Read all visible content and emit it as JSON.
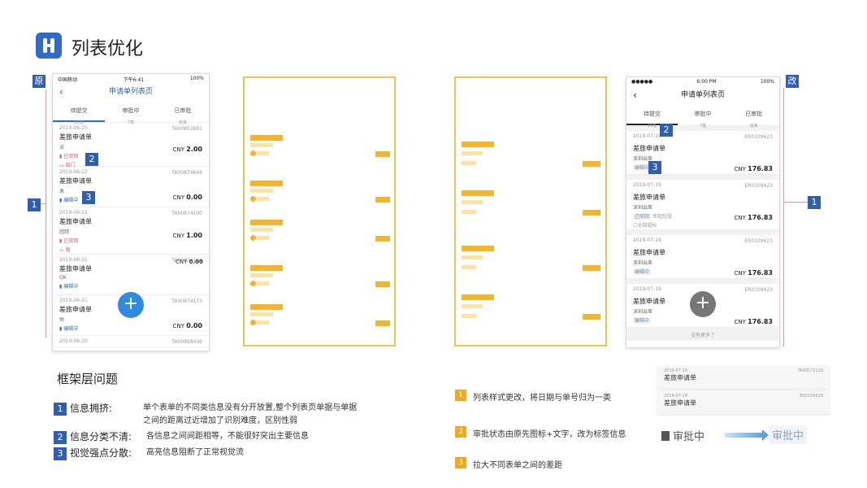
{
  "header": {
    "title": "列表优化"
  },
  "labels": {
    "orig": "原",
    "new": "改"
  },
  "markers": {
    "m1": "1",
    "m2": "2",
    "m3": "3"
  },
  "phone_orig": {
    "status": {
      "carrier": "中国移动",
      "time": "下午6:41",
      "battery": "100%"
    },
    "nav": {
      "back": "‹",
      "title": "申请单列表页"
    },
    "tabs": [
      {
        "label": "待提交",
        "sub": "19笔"
      },
      {
        "label": "审批中",
        "sub": "7笔"
      },
      {
        "label": "已审批",
        "sub": "结束"
      }
    ],
    "cards": [
      {
        "date": "2019-06-25",
        "no": "TA00853881",
        "title": "差旅申请单",
        "sub": "汝",
        "status": "已驳回",
        "status2": "部门",
        "cny": "CNY",
        "amount": "2.00"
      },
      {
        "date": "2019-06-22",
        "no": "TA00874648",
        "title": "差旅申请单",
        "sub": "发",
        "status": "编辑中",
        "cny": "CNY",
        "amount": "0.00"
      },
      {
        "date": "2019-06-21",
        "no": "TA00874100",
        "title": "差旅申请单",
        "sub": "团拜",
        "status": "已驳回",
        "status2": "版",
        "cny": "CNY",
        "amount": "1.00"
      },
      {
        "date": "2019-06-21",
        "no": "TA00874184",
        "title": "差旅申请单",
        "sub": "OK",
        "status": "编辑中",
        "cny": "CNY",
        "amount": "0.00"
      },
      {
        "date": "2019-06-21",
        "no": "TA00874173",
        "title": "差旅申请单",
        "sub": "恒",
        "status": "编辑中",
        "cny": "CNY",
        "amount": "0.00"
      },
      {
        "date": "2019-06-20",
        "no": "TA00868436"
      }
    ],
    "fab": "+"
  },
  "phone_new": {
    "status": {
      "carrier": "●●●●● ",
      "time": "6:00 PM",
      "battery": "100%"
    },
    "nav": {
      "back": "‹",
      "title": "申请单列表页"
    },
    "tabs": [
      {
        "label": "待提交",
        "sub": "15笔"
      },
      {
        "label": "审批中",
        "sub": "7笔"
      },
      {
        "label": "已审批",
        "sub": "结束"
      }
    ],
    "cards": [
      {
        "date": "2019-07-19",
        "no": "ER0109423",
        "title": "差旅申请单",
        "sub": "深圳出差",
        "status": "编辑中",
        "cny": "CNY",
        "amount": "176.83"
      },
      {
        "date": "2019-07-19",
        "no": "ER0109423",
        "title": "差旅申请单",
        "sub": "深圳出差",
        "status": "已驳回",
        "status_b": "审批阶段",
        "extra": "全部超标",
        "cny": "CNY",
        "amount": "176.83"
      },
      {
        "date": "2019-07-19",
        "no": "ER0109423",
        "title": "差旅申请单",
        "sub": "深圳出差",
        "status": "编辑中",
        "cny": "CNY",
        "amount": "176.83"
      },
      {
        "date": "2019-07-19",
        "no": "ER0109423",
        "title": "差旅申请单",
        "sub": "深圳出差",
        "status": "编辑中",
        "cny": "CNY",
        "amount": "176.83"
      }
    ],
    "footer": "没有更多了",
    "fab": "+"
  },
  "problems": {
    "heading": "框架层问题",
    "items": [
      {
        "n": "1",
        "title": "信息拥挤:",
        "desc1": "单个表单的不同类信息没有分开放置,整个列表页单据与单据",
        "desc2": "之间的距离过近增加了识别难度，区别性弱"
      },
      {
        "n": "2",
        "title": "信息分类不清:",
        "desc1": "各信息之间间距相等，不能很好突出主要信息"
      },
      {
        "n": "3",
        "title": "视觉强点分散:",
        "desc1": "高亮信息阻断了正常视觉流"
      }
    ]
  },
  "improvements": [
    {
      "n": "1",
      "text": "列表样式更改，将日期与单号归为一类"
    },
    {
      "n": "2",
      "text": "审批状态由原先图标+文字，改为标签信息"
    },
    {
      "n": "3",
      "text": "拉大不同表单之间的差距"
    }
  ],
  "mini": [
    {
      "date": "2019-07-19",
      "no": "TA00172118",
      "title": "差旅申请单"
    },
    {
      "date": "2019-07-19",
      "no": "ER0109428",
      "title": "差旅申请单"
    }
  ],
  "status_demo": {
    "before": "审批中",
    "after": "审批中"
  }
}
